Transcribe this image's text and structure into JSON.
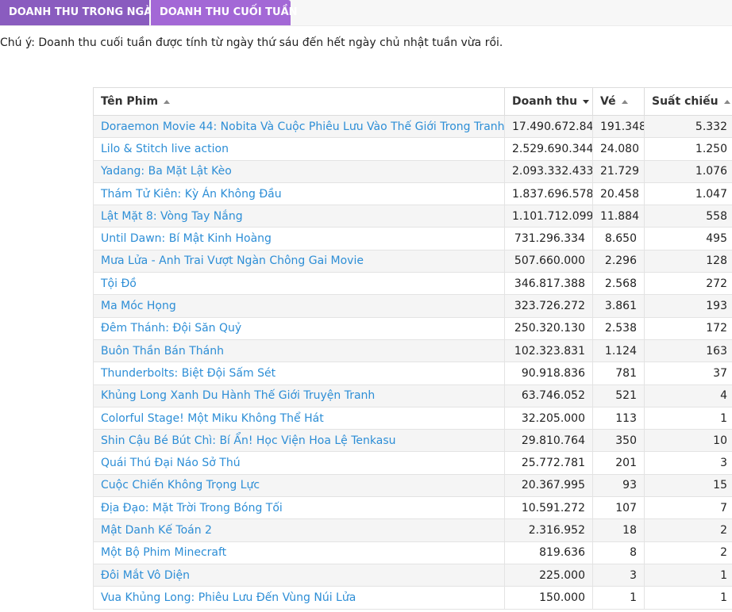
{
  "tabs": [
    {
      "label": "DOANH THU TRONG NGÀY",
      "active": false
    },
    {
      "label": "DOANH THU CUỐI TUẦN",
      "active": true
    }
  ],
  "note": "Chú ý: Doanh thu cuối tuần được tính từ ngày thứ sáu đến hết ngày chủ nhật tuần vừa rồi.",
  "table": {
    "headers": [
      "Tên Phim",
      "Doanh thu",
      "Vé",
      "Suất chiếu"
    ],
    "sort_active_column": "Doanh thu",
    "rows": [
      {
        "title": "Doraemon Movie 44: Nobita Và Cuộc Phiêu Lưu Vào Thế Giới Trong Tranh",
        "revenue": "17.490.672.843",
        "tickets": "191.348",
        "shows": "5.332"
      },
      {
        "title": "Lilo & Stitch live action",
        "revenue": "2.529.690.344",
        "tickets": "24.080",
        "shows": "1.250"
      },
      {
        "title": "Yadang: Ba Mặt Lật Kèo",
        "revenue": "2.093.332.433",
        "tickets": "21.729",
        "shows": "1.076"
      },
      {
        "title": "Thám Tử Kiên: Kỳ Án Không Đầu",
        "revenue": "1.837.696.578",
        "tickets": "20.458",
        "shows": "1.047"
      },
      {
        "title": "Lật Mặt 8: Vòng Tay Nắng",
        "revenue": "1.101.712.099",
        "tickets": "11.884",
        "shows": "558"
      },
      {
        "title": "Until Dawn: Bí Mật Kinh Hoàng",
        "revenue": "731.296.334",
        "tickets": "8.650",
        "shows": "495"
      },
      {
        "title": "Mưa Lửa - Anh Trai Vượt Ngàn Chông Gai Movie",
        "revenue": "507.660.000",
        "tickets": "2.296",
        "shows": "128"
      },
      {
        "title": "Tội Đồ",
        "revenue": "346.817.388",
        "tickets": "2.568",
        "shows": "272"
      },
      {
        "title": "Ma Móc Họng",
        "revenue": "323.726.272",
        "tickets": "3.861",
        "shows": "193"
      },
      {
        "title": "Đêm Thánh: Đội Săn Quỷ",
        "revenue": "250.320.130",
        "tickets": "2.538",
        "shows": "172"
      },
      {
        "title": "Buôn Thần Bán Thánh",
        "revenue": "102.323.831",
        "tickets": "1.124",
        "shows": "163"
      },
      {
        "title": "Thunderbolts: Biệt Đội Sấm Sét",
        "revenue": "90.918.836",
        "tickets": "781",
        "shows": "37"
      },
      {
        "title": "Khủng Long Xanh Du Hành Thế Giới Truyện Tranh",
        "revenue": "63.746.052",
        "tickets": "521",
        "shows": "4"
      },
      {
        "title": "Colorful Stage! Một Miku Không Thể Hát",
        "revenue": "32.205.000",
        "tickets": "113",
        "shows": "1"
      },
      {
        "title": "Shin Cậu Bé Bút Chì: Bí Ẩn! Học Viện Hoa Lệ Tenkasu",
        "revenue": "29.810.764",
        "tickets": "350",
        "shows": "10"
      },
      {
        "title": "Quái Thú Đại Náo Sở Thú",
        "revenue": "25.772.781",
        "tickets": "201",
        "shows": "3"
      },
      {
        "title": "Cuộc Chiến Không Trọng Lực",
        "revenue": "20.367.995",
        "tickets": "93",
        "shows": "15"
      },
      {
        "title": "Địa Đạo: Mặt Trời Trong Bóng Tối",
        "revenue": "10.591.272",
        "tickets": "107",
        "shows": "7"
      },
      {
        "title": "Mật Danh Kế Toán 2",
        "revenue": "2.316.952",
        "tickets": "18",
        "shows": "2"
      },
      {
        "title": "Một Bộ Phim Minecraft",
        "revenue": "819.636",
        "tickets": "8",
        "shows": "2"
      },
      {
        "title": "Đôi Mắt Vô Diện",
        "revenue": "225.000",
        "tickets": "3",
        "shows": "1"
      },
      {
        "title": "Vua Khủng Long: Phiêu Lưu Đến Vùng Núi Lửa",
        "revenue": "150.000",
        "tickets": "1",
        "shows": "1"
      }
    ]
  }
}
